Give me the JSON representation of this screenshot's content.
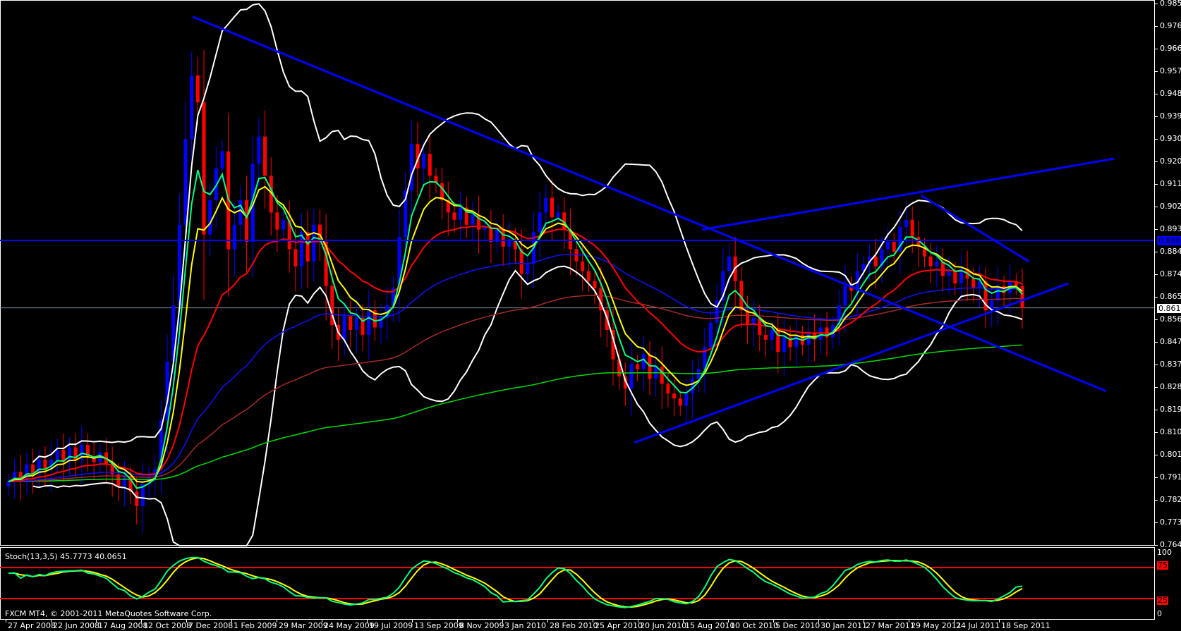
{
  "window": {
    "platform": "FXCM MT4",
    "copyright": "FXCM MT4, © 2001-2011 MetaQuotes Software Corp."
  },
  "colors": {
    "background": "#000000",
    "bull_candle": "#0000ff",
    "bear_candle": "#ff0000",
    "ma_fast": "#00ff80",
    "ma_mid": "#ffff00",
    "ma_slow": "#ff0000",
    "ma_blue": "#1010ff",
    "ma_long": "#a52a2a",
    "ma_longest": "#00dd00",
    "bands": "#ffffff",
    "trendline": "#0000ff",
    "stoch_main": "#00ff80",
    "stoch_signal": "#ffff00",
    "stoch_level": "#ff0000"
  },
  "price_axis": {
    "labels": [
      "0.98540",
      "0.97615",
      "0.96690",
      "0.95790",
      "0.94865",
      "0.93940",
      "0.93015",
      "0.92090",
      "0.91165",
      "0.90240",
      "0.89340",
      "0.88415",
      "0.87490",
      "0.86565",
      "0.85640",
      "0.84715",
      "0.83790",
      "0.82890",
      "0.81965",
      "0.81040",
      "0.80115",
      "0.79190",
      "0.78265",
      "0.77365",
      "0.76440"
    ],
    "horizontal_line_label": "0.88858",
    "current_price_label": "0.86104"
  },
  "time_axis": {
    "labels": [
      "27 Apr 2008",
      "22 Jun 2008",
      "17 Aug 2008",
      "12 Oct 2008",
      "7 Dec 2008",
      "1 Feb 2009",
      "29 Mar 2009",
      "24 May 2009",
      "19 Jul 2009",
      "13 Sep 2009",
      "8 Nov 2009",
      "3 Jan 2010",
      "28 Feb 2010",
      "25 Apr 2010",
      "20 Jun 2010",
      "15 Aug 2010",
      "10 Oct 2010",
      "5 Dec 2010",
      "30 Jan 2011",
      "27 Mar 2011",
      "29 May 2011",
      "24 Jul 2011",
      "18 Sep 2011"
    ]
  },
  "stochastic": {
    "title": "Stoch(13,3,5) 45.7773 40.0651",
    "levels": {
      "max": "100",
      "upper": "75",
      "lower": "25",
      "min": "0"
    }
  },
  "chart_data": {
    "type": "candlestick",
    "timeframe": "weekly",
    "ylim": [
      0.7644,
      0.9854
    ],
    "first_date": "2008-04-27",
    "closes": [
      0.79,
      0.794,
      0.791,
      0.797,
      0.793,
      0.799,
      0.795,
      0.799,
      0.803,
      0.798,
      0.804,
      0.799,
      0.805,
      0.8,
      0.798,
      0.802,
      0.797,
      0.793,
      0.788,
      0.792,
      0.786,
      0.78,
      0.789,
      0.792,
      0.795,
      0.815,
      0.839,
      0.862,
      0.895,
      0.93,
      0.956,
      0.945,
      0.891,
      0.905,
      0.918,
      0.925,
      0.885,
      0.895,
      0.905,
      0.888,
      0.92,
      0.931,
      0.915,
      0.9,
      0.893,
      0.897,
      0.885,
      0.878,
      0.892,
      0.88,
      0.895,
      0.888,
      0.87,
      0.854,
      0.848,
      0.858,
      0.852,
      0.857,
      0.85,
      0.86,
      0.853,
      0.857,
      0.862,
      0.869,
      0.89,
      0.909,
      0.928,
      0.918,
      0.924,
      0.915,
      0.912,
      0.905,
      0.9,
      0.897,
      0.902,
      0.895,
      0.899,
      0.893,
      0.894,
      0.888,
      0.893,
      0.886,
      0.889,
      0.885,
      0.875,
      0.879,
      0.892,
      0.9,
      0.906,
      0.898,
      0.9,
      0.893,
      0.885,
      0.88,
      0.876,
      0.872,
      0.869,
      0.86,
      0.852,
      0.84,
      0.833,
      0.828,
      0.838,
      0.836,
      0.842,
      0.832,
      0.837,
      0.83,
      0.826,
      0.824,
      0.821,
      0.826,
      0.832,
      0.836,
      0.845,
      0.855,
      0.864,
      0.876,
      0.882,
      0.872,
      0.86,
      0.854,
      0.857,
      0.85,
      0.848,
      0.852,
      0.843,
      0.849,
      0.845,
      0.85,
      0.846,
      0.851,
      0.848,
      0.853,
      0.849,
      0.854,
      0.862,
      0.87,
      0.868,
      0.876,
      0.879,
      0.882,
      0.878,
      0.885,
      0.888,
      0.884,
      0.894,
      0.897,
      0.89,
      0.886,
      0.882,
      0.878,
      0.88,
      0.874,
      0.876,
      0.871,
      0.877,
      0.873,
      0.869,
      0.872,
      0.86,
      0.864,
      0.87,
      0.867,
      0.872,
      0.87,
      0.861
    ],
    "horizontal_line": 0.88858,
    "current_price": 0.86104,
    "trendlines": [
      {
        "from": [
          "2008-12-15",
          0.98
        ],
        "to": [
          "2012-01-22",
          0.827
        ]
      },
      {
        "from": [
          "2010-06-16",
          0.806
        ],
        "to": [
          "2011-12-06",
          0.871
        ]
      },
      {
        "from": [
          "2010-09-08",
          0.893
        ],
        "to": [
          "2012-02-01",
          0.922
        ]
      },
      {
        "from": [
          "2011-06-06",
          0.907
        ],
        "to": [
          "2011-10-18",
          0.88
        ]
      }
    ],
    "indicators": {
      "moving_averages": [
        {
          "color_key": "ma_fast",
          "period": 5
        },
        {
          "color_key": "ma_mid",
          "period": 8
        },
        {
          "color_key": "ma_slow",
          "period": 21
        },
        {
          "color_key": "ma_blue",
          "period": 55
        },
        {
          "color_key": "ma_long",
          "period": 100
        },
        {
          "color_key": "ma_longest",
          "period": 250
        }
      ],
      "bollinger": {
        "period": 20,
        "deviations": 2
      },
      "stochastic": {
        "k": 13,
        "d": 3,
        "slowing": 5,
        "main": 45.7773,
        "signal": 40.0651,
        "levels": [
          75,
          25
        ]
      }
    }
  }
}
